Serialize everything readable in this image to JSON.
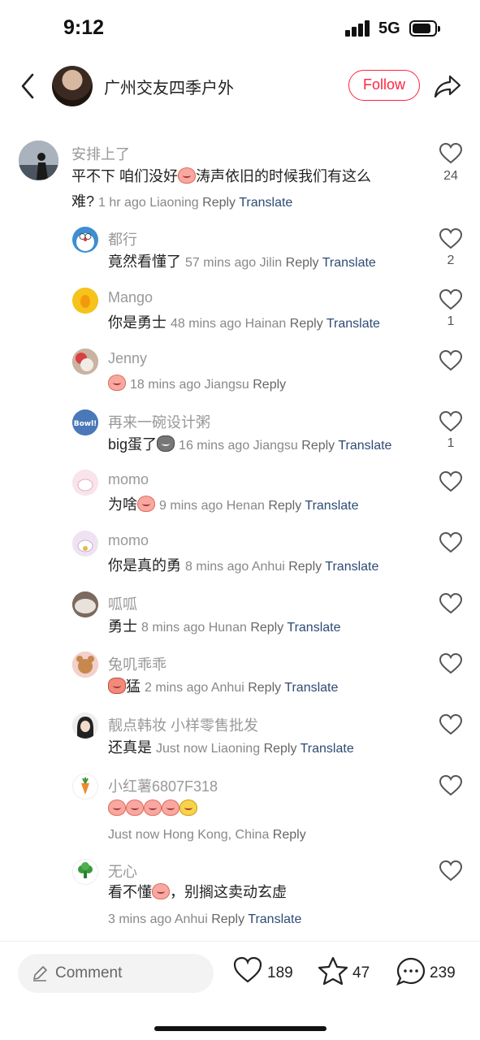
{
  "status_bar": {
    "time": "9:12",
    "network": "5G",
    "battery_level": 0.8
  },
  "header": {
    "title": "广州交友四季户外",
    "follow_label": "Follow"
  },
  "comments": [
    {
      "name": "安排上了",
      "text": "平不下 咱们没好",
      "text2": "涛声依旧的时候我们有这么",
      "line2": "难?",
      "meta": "1 hr ago Liaoning",
      "reply": "Reply",
      "translate": "Translate",
      "likes": "24",
      "avatar_color": "#6a7480"
    },
    {
      "name": "都行",
      "text": "竟然看懂了",
      "meta": "57 mins ago Jilin",
      "reply": "Reply",
      "translate": "Translate",
      "likes": "2",
      "avatar_color": "#8fc2e8"
    },
    {
      "name": "Mango",
      "text": "你是勇士",
      "meta": "48 mins ago Hainan",
      "reply": "Reply",
      "translate": "Translate",
      "likes": "1",
      "avatar_color": "#f6c21c"
    },
    {
      "name": "Jenny",
      "text": "",
      "meta": "18 mins ago Jiangsu",
      "reply": "Reply",
      "translate": "",
      "likes": "",
      "avatar_color": "#b89e88"
    },
    {
      "name": "再来一碗设计粥",
      "text": "big蛋了",
      "meta": "16 mins ago Jiangsu",
      "reply": "Reply",
      "translate": "Translate",
      "likes": "1",
      "avatar_color": "#4a78b8",
      "avatar_text": "Bowl!"
    },
    {
      "name": "momo",
      "text": "为啥",
      "meta": "9 mins ago Henan",
      "reply": "Reply",
      "translate": "Translate",
      "likes": "",
      "avatar_color": "#f6dfe6"
    },
    {
      "name": "momo",
      "text": "你是真的勇",
      "meta": "8 mins ago Anhui",
      "reply": "Reply",
      "translate": "Translate",
      "likes": "",
      "avatar_color": "#efe6f2"
    },
    {
      "name": "呱呱",
      "text": "勇士",
      "meta": "8 mins ago Hunan",
      "reply": "Reply",
      "translate": "Translate",
      "likes": "",
      "avatar_color": "#9a8a80"
    },
    {
      "name": "兔叽乖乖",
      "text": "猛",
      "meta": "2 mins ago Anhui",
      "reply": "Reply",
      "translate": "Translate",
      "likes": "",
      "avatar_color": "#d9a88c"
    },
    {
      "name": "靓点韩妆 小样零售批发",
      "text": "还真是",
      "meta": "Just now Liaoning",
      "reply": "Reply",
      "translate": "Translate",
      "likes": "",
      "avatar_color": "#e8e8e8"
    },
    {
      "name": "小红薯6807F318",
      "text": "",
      "meta": "Just now Hong Kong, China",
      "reply": "Reply",
      "translate": "",
      "likes": "",
      "avatar_color": "#ffffff"
    },
    {
      "name": "无心",
      "text": "看不懂",
      "text2": "，别搁这卖动玄虚",
      "meta": "3 mins ago Anhui",
      "reply": "Reply",
      "translate": "Translate",
      "likes": "",
      "avatar_color": "#ffffff"
    }
  ],
  "bottom_bar": {
    "comment_placeholder": "Comment",
    "likes": "189",
    "favorites": "47",
    "comments": "239"
  }
}
